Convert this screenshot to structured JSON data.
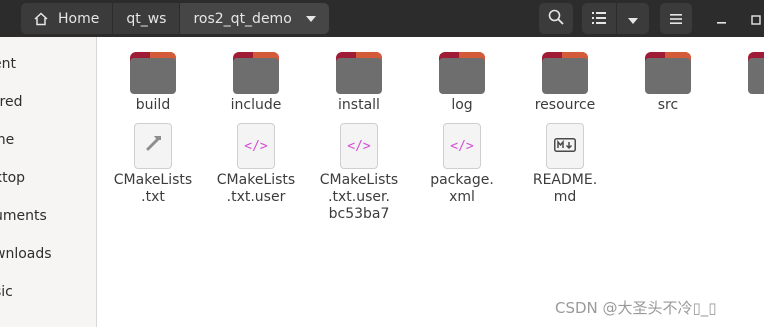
{
  "breadcrumb": [
    "Home",
    "qt_ws",
    "ros2_qt_demo"
  ],
  "sidebar": {
    "items": [
      "ent",
      "rred",
      "me",
      "ktop",
      "uments",
      "wnloads",
      "sic"
    ]
  },
  "folders": [
    "build",
    "include",
    "install",
    "log",
    "resource",
    "src"
  ],
  "files": [
    {
      "lines": [
        "CMakeLists",
        ".txt"
      ]
    },
    {
      "lines": [
        "CMakeLists",
        ".txt.user"
      ]
    },
    {
      "lines": [
        "CMakeLists",
        ".txt.user.",
        "bc53ba7"
      ]
    },
    {
      "lines": [
        "package.",
        "xml"
      ]
    },
    {
      "lines": [
        "README.",
        "md"
      ]
    }
  ],
  "watermark": "CSDN @大圣头不冷▯_▯",
  "colors": {
    "header_bg": "#2c2c2c",
    "folder_body": "#6e6e6e",
    "folder_tab": "#a01c36",
    "folder_tab_accent": "#d35b3a",
    "xml_icon": "#d44dd4"
  }
}
